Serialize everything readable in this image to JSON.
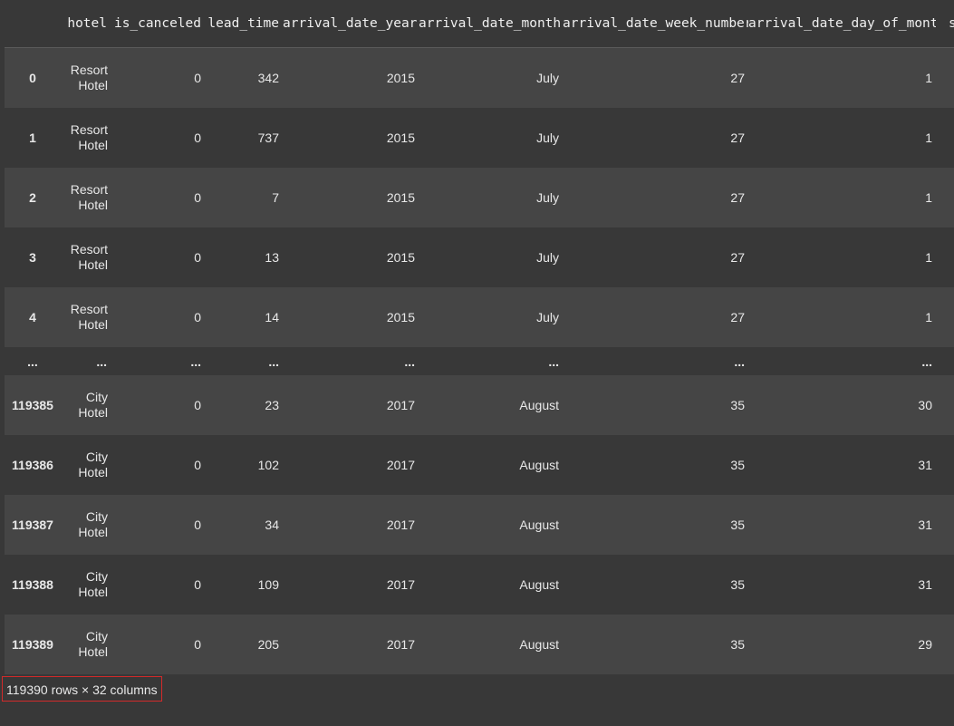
{
  "dataframe": {
    "columns": [
      "",
      "hotel",
      "is_canceled",
      "lead_time",
      "arrival_date_year",
      "arrival_date_month",
      "arrival_date_week_number",
      "arrival_date_day_of_month",
      "s"
    ],
    "top_rows": [
      {
        "index": "0",
        "hotel": "Resort Hotel",
        "is_canceled": "0",
        "lead_time": "342",
        "arrival_date_year": "2015",
        "arrival_date_month": "July",
        "arrival_date_week_number": "27",
        "arrival_date_day_of_month": "1"
      },
      {
        "index": "1",
        "hotel": "Resort Hotel",
        "is_canceled": "0",
        "lead_time": "737",
        "arrival_date_year": "2015",
        "arrival_date_month": "July",
        "arrival_date_week_number": "27",
        "arrival_date_day_of_month": "1"
      },
      {
        "index": "2",
        "hotel": "Resort Hotel",
        "is_canceled": "0",
        "lead_time": "7",
        "arrival_date_year": "2015",
        "arrival_date_month": "July",
        "arrival_date_week_number": "27",
        "arrival_date_day_of_month": "1"
      },
      {
        "index": "3",
        "hotel": "Resort Hotel",
        "is_canceled": "0",
        "lead_time": "13",
        "arrival_date_year": "2015",
        "arrival_date_month": "July",
        "arrival_date_week_number": "27",
        "arrival_date_day_of_month": "1"
      },
      {
        "index": "4",
        "hotel": "Resort Hotel",
        "is_canceled": "0",
        "lead_time": "14",
        "arrival_date_year": "2015",
        "arrival_date_month": "July",
        "arrival_date_week_number": "27",
        "arrival_date_day_of_month": "1"
      }
    ],
    "ellipsis": "...",
    "bottom_rows": [
      {
        "index": "119385",
        "hotel": "City Hotel",
        "is_canceled": "0",
        "lead_time": "23",
        "arrival_date_year": "2017",
        "arrival_date_month": "August",
        "arrival_date_week_number": "35",
        "arrival_date_day_of_month": "30"
      },
      {
        "index": "119386",
        "hotel": "City Hotel",
        "is_canceled": "0",
        "lead_time": "102",
        "arrival_date_year": "2017",
        "arrival_date_month": "August",
        "arrival_date_week_number": "35",
        "arrival_date_day_of_month": "31"
      },
      {
        "index": "119387",
        "hotel": "City Hotel",
        "is_canceled": "0",
        "lead_time": "34",
        "arrival_date_year": "2017",
        "arrival_date_month": "August",
        "arrival_date_week_number": "35",
        "arrival_date_day_of_month": "31"
      },
      {
        "index": "119388",
        "hotel": "City Hotel",
        "is_canceled": "0",
        "lead_time": "109",
        "arrival_date_year": "2017",
        "arrival_date_month": "August",
        "arrival_date_week_number": "35",
        "arrival_date_day_of_month": "31"
      },
      {
        "index": "119389",
        "hotel": "City Hotel",
        "is_canceled": "0",
        "lead_time": "205",
        "arrival_date_year": "2017",
        "arrival_date_month": "August",
        "arrival_date_week_number": "35",
        "arrival_date_day_of_month": "29"
      }
    ],
    "shape_text": "119390 rows × 32 columns"
  },
  "colors": {
    "background": "#383838",
    "row_stripe": "#454545",
    "highlight_border": "#d22a2a"
  }
}
